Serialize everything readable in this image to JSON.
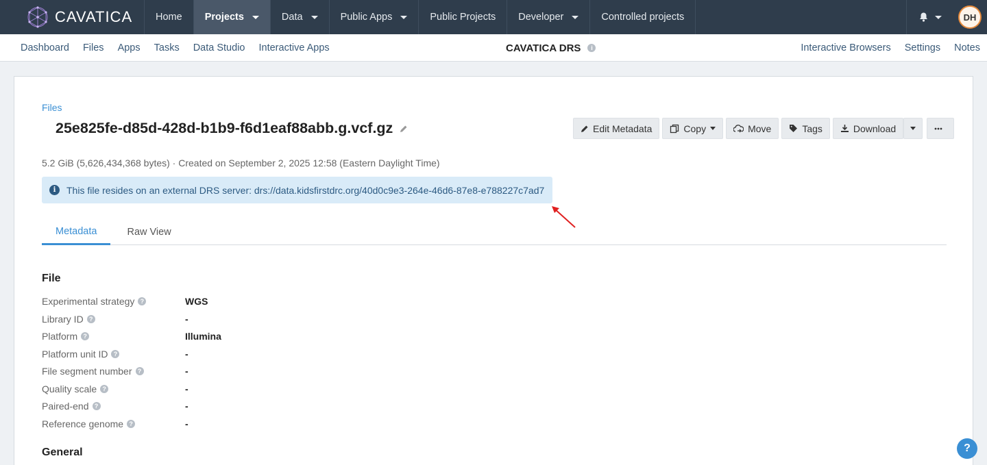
{
  "topnav": {
    "brand": "CAVATICA",
    "items": [
      {
        "label": "Home",
        "caret": false,
        "active": false
      },
      {
        "label": "Projects",
        "caret": true,
        "active": true
      },
      {
        "label": "Data",
        "caret": true,
        "active": false
      },
      {
        "label": "Public Apps",
        "caret": true,
        "active": false
      },
      {
        "label": "Public Projects",
        "caret": false,
        "active": false
      },
      {
        "label": "Developer",
        "caret": true,
        "active": false
      },
      {
        "label": "Controlled projects",
        "caret": false,
        "active": false
      }
    ],
    "user_initials": "DH"
  },
  "subnav": {
    "left": [
      "Dashboard",
      "Files",
      "Apps",
      "Tasks",
      "Data Studio",
      "Interactive Apps"
    ],
    "project_title": "CAVATICA DRS",
    "right": [
      "Interactive Browsers",
      "Settings",
      "Notes"
    ]
  },
  "file": {
    "breadcrumb": "Files",
    "name": "25e825fe-d85d-428d-b1b9-f6d1eaf88abb.g.vcf.gz",
    "meta": "5.2 GiB (5,626,434,368 bytes) · Created on September 2, 2025 12:58 (Eastern Daylight Time)",
    "alert": "This file resides on an external DRS server: drs://data.kidsfirstdrc.org/40d0c9e3-264e-46d6-87e8-e788227c7ad7"
  },
  "actions": {
    "edit_metadata": "Edit Metadata",
    "copy": "Copy",
    "move": "Move",
    "tags": "Tags",
    "download": "Download"
  },
  "tabs": {
    "metadata": "Metadata",
    "raw_view": "Raw View"
  },
  "sections": {
    "file_title": "File",
    "general_title": "General",
    "file_rows": [
      {
        "label": "Experimental strategy",
        "value": "WGS"
      },
      {
        "label": "Library ID",
        "value": "-"
      },
      {
        "label": "Platform",
        "value": "Illumina"
      },
      {
        "label": "Platform unit ID",
        "value": "-"
      },
      {
        "label": "File segment number",
        "value": "-"
      },
      {
        "label": "Quality scale",
        "value": "-"
      },
      {
        "label": "Paired-end",
        "value": "-"
      },
      {
        "label": "Reference genome",
        "value": "-"
      }
    ]
  },
  "help_label": "?",
  "colors": {
    "topnav_bg": "#2f3d4c",
    "accent": "#3a8fd4",
    "alert_bg": "#d9ebf8",
    "annotation_arrow": "#e02020"
  }
}
